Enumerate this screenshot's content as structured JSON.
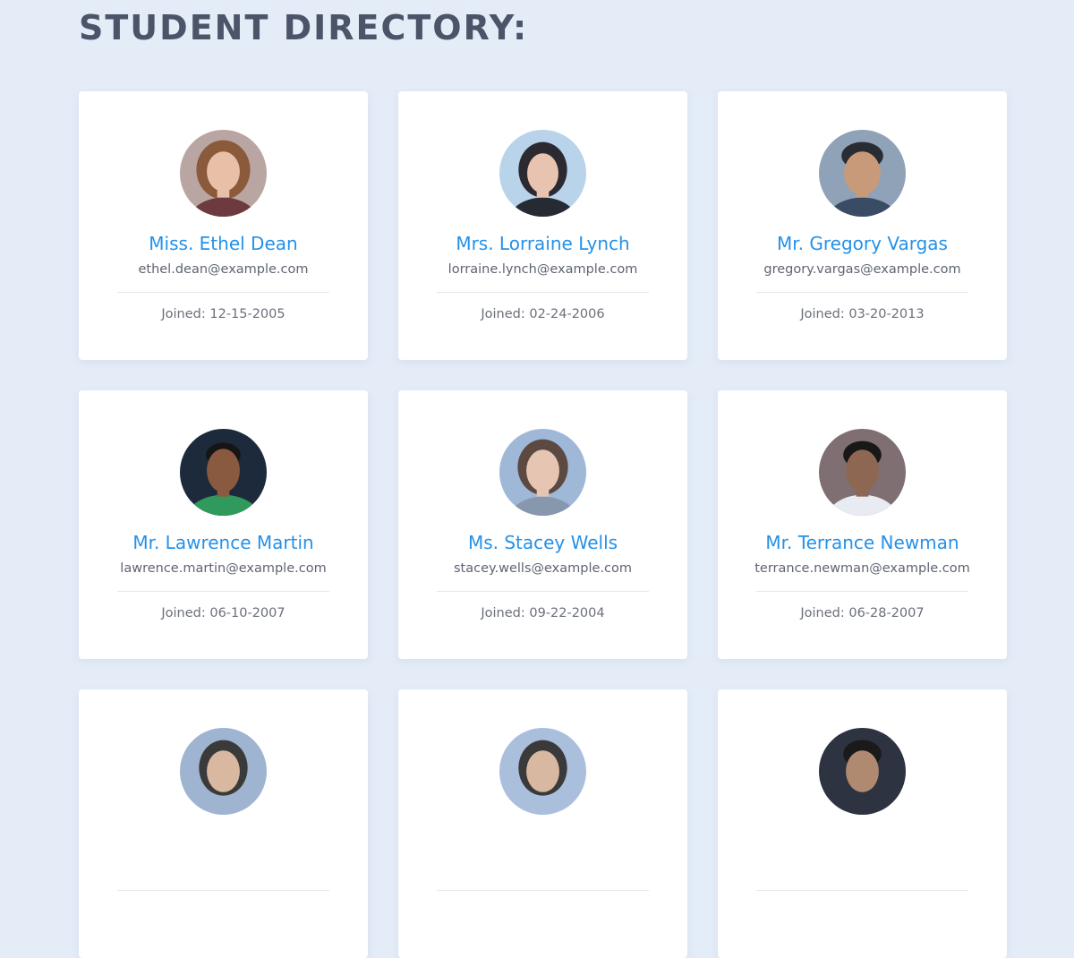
{
  "page": {
    "title": "STUDENT DIRECTORY:"
  },
  "students": [
    {
      "name": "Miss. Ethel Dean",
      "email": "ethel.dean@example.com",
      "joined": "Joined: 12-15-2005",
      "avatar": {
        "bg": "#b9a6a3",
        "hair": "#8a5a3b",
        "skin": "#e8c0a8",
        "shirt": "#6d3b3f"
      }
    },
    {
      "name": "Mrs. Lorraine Lynch",
      "email": "lorraine.lynch@example.com",
      "joined": "Joined: 02-24-2006",
      "avatar": {
        "bg": "#b9d3ea",
        "hair": "#2b2a30",
        "skin": "#e8c4b0",
        "shirt": "#262a33"
      }
    },
    {
      "name": "Mr. Gregory Vargas",
      "email": "gregory.vargas@example.com",
      "joined": "Joined: 03-20-2013",
      "avatar": {
        "bg": "#8fa2b8",
        "hair": "#2a2c33",
        "skin": "#c99a7a",
        "shirt": "#3a4c63"
      }
    },
    {
      "name": "Mr. Lawrence Martin",
      "email": "lawrence.martin@example.com",
      "joined": "Joined: 06-10-2007",
      "avatar": {
        "bg": "#1d2a3b",
        "hair": "#151515",
        "skin": "#8a5a40",
        "shirt": "#2f9a5c"
      }
    },
    {
      "name": "Ms. Stacey Wells",
      "email": "stacey.wells@example.com",
      "joined": "Joined: 09-22-2004",
      "avatar": {
        "bg": "#9fb8d8",
        "hair": "#5c4a42",
        "skin": "#e6c5b2",
        "shirt": "#8797ad"
      }
    },
    {
      "name": "Mr. Terrance Newman",
      "email": "terrance.newman@example.com",
      "joined": "Joined: 06-28-2007",
      "avatar": {
        "bg": "#7f6f73",
        "hair": "#181818",
        "skin": "#8e6752",
        "shirt": "#e8ecf2"
      }
    },
    {
      "name": "",
      "email": "",
      "joined": "",
      "avatar": {
        "bg": "#9fb4d0",
        "hair": "#3a3a3a",
        "skin": "#d8b8a0",
        "shirt": "#5a6a80"
      }
    },
    {
      "name": "",
      "email": "",
      "joined": "",
      "avatar": {
        "bg": "#a9bfdc",
        "hair": "#3a3a3a",
        "skin": "#d8b8a0",
        "shirt": "#5a6a80"
      }
    },
    {
      "name": "",
      "email": "",
      "joined": "",
      "avatar": {
        "bg": "#2d3340",
        "hair": "#1a1a1a",
        "skin": "#b08a70",
        "shirt": "#3a3f4c"
      }
    }
  ]
}
